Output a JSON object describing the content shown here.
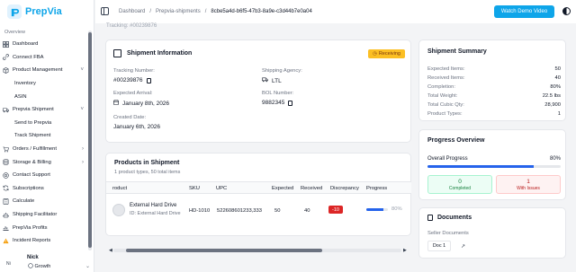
{
  "app": {
    "name": "PrepVia",
    "brand_color": "#0ea5e9"
  },
  "sidebar": {
    "section": "Overview",
    "items": [
      {
        "label": "Dashboard",
        "icon": "dashboard-icon"
      },
      {
        "label": "Connect FBA",
        "icon": "link-icon"
      },
      {
        "label": "Product Management",
        "icon": "box-icon",
        "chevron": "˅"
      },
      {
        "label": "Inventory",
        "sub": true
      },
      {
        "label": "ASIN",
        "sub": true
      },
      {
        "label": "Prepvia Shipment",
        "icon": "truck-icon",
        "chevron": "˅"
      },
      {
        "label": "Send to Prepvia",
        "sub": true
      },
      {
        "label": "Track Shipment",
        "sub": true
      },
      {
        "label": "Orders / Fulfillment",
        "icon": "cart-icon",
        "chevron": "›"
      },
      {
        "label": "Storage & Billing",
        "icon": "storage-icon",
        "chevron": "›"
      },
      {
        "label": "Contact Support",
        "icon": "support-icon"
      },
      {
        "label": "Subscriptions",
        "icon": "refresh-icon"
      },
      {
        "label": "Calculate",
        "icon": "calculator-icon"
      },
      {
        "label": "Shipping Facilitator",
        "icon": "ship-icon"
      },
      {
        "label": "PrepVia Profits",
        "icon": "chart-icon"
      },
      {
        "label": "Incident Reports",
        "icon": "warning-icon"
      }
    ],
    "user": {
      "initials": "Ni",
      "name": "Nick",
      "plan": "Growth"
    }
  },
  "topbar": {
    "breadcrumbs": [
      "Dashboard",
      "Prepvia-shipments",
      "8cbe5a4d-b6f5-47b3-8a9e-c3d44b7e0a04"
    ],
    "separator": "/",
    "demo_button": "Watch Demo Video"
  },
  "tracking_line": "Tracking: #00239876",
  "shipment_info": {
    "title": "Shipment Information",
    "status": "Receiving",
    "tracking_label": "Tracking Number:",
    "tracking_value": "#00239876",
    "agency_label": "Shipping Agency:",
    "agency_value": "LTL",
    "arrival_label": "Expected Arrival:",
    "arrival_value": "January 8th, 2026",
    "bol_label": "BOL Number:",
    "bol_value": "9882345",
    "created_label": "Created Date:",
    "created_value": "January 6th, 2026"
  },
  "products": {
    "title": "Products in Shipment",
    "subtitle": "1 product types, 50 total items",
    "columns": [
      "roduct",
      "SKU",
      "UPC",
      "Expected",
      "Received",
      "Discrepancy",
      "Progress"
    ],
    "rows": [
      {
        "name": "External Hard Drive",
        "id": "ID: External Hard Drive",
        "sku": "HD-1010",
        "upc": "522608601233,333",
        "expected": "50",
        "received": "40",
        "discrepancy": "-10",
        "progress": 0.8,
        "progress_text": "80%"
      }
    ]
  },
  "summary": {
    "title": "Shipment Summary",
    "rows": [
      {
        "label": "Expected Items:",
        "value": "50"
      },
      {
        "label": "Received Items:",
        "value": "40"
      },
      {
        "label": "Completion:",
        "value": "80%"
      },
      {
        "label": "Total Weight:",
        "value": "22.5 lbs"
      },
      {
        "label": "Total Cubic Qty:",
        "value": "28,900"
      },
      {
        "label": "Product Types:",
        "value": "1"
      }
    ]
  },
  "progress": {
    "title": "Progress Overview",
    "overall_label": "Overall Progress",
    "overall_value": "80%",
    "overall_fraction": 0.8,
    "completed_count": "0",
    "completed_label": "Completed",
    "issues_count": "1",
    "issues_label": "With Issues"
  },
  "documents": {
    "title": "Documents",
    "seller_label": "Seller Documents",
    "doc_button": "Doc 1"
  }
}
